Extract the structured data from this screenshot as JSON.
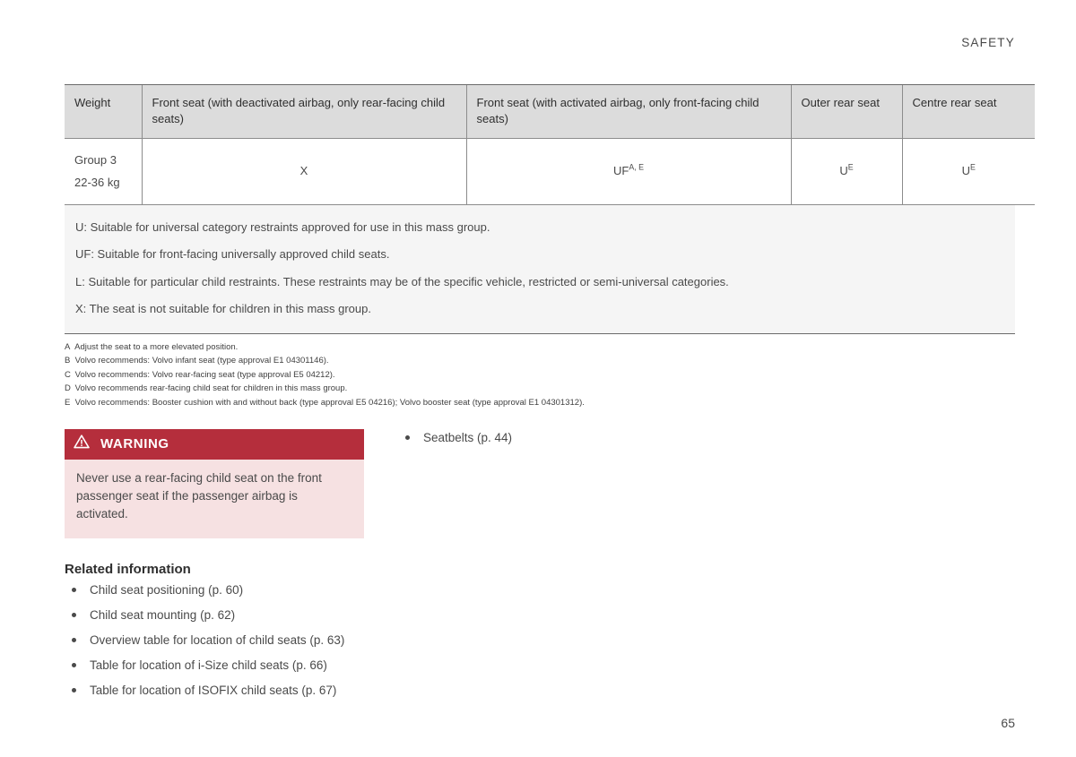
{
  "header": {
    "section_title": "SAFETY"
  },
  "page": {
    "number": "65"
  },
  "table": {
    "columns": [
      "Weight",
      "Front seat (with deactivated airbag, only rear-facing child seats)",
      "Front seat (with activated airbag, only front-facing child seats)",
      "Outer rear seat",
      "Centre rear seat"
    ],
    "row": {
      "weight_group": "Group 3",
      "weight_range": "22-36 kg",
      "front_deactivated": "X",
      "front_activated_code": "UF",
      "front_activated_sup": "A, E",
      "outer_rear_code": "U",
      "outer_rear_sup": "E",
      "centre_rear_code": "U",
      "centre_rear_sup": "E"
    }
  },
  "legend": [
    "U: Suitable for universal category restraints approved for use in this mass group.",
    "UF: Suitable for front-facing universally approved child seats.",
    "L: Suitable for particular child restraints. These restraints may be of the specific vehicle, restricted or semi-universal categories.",
    "X: The seat is not suitable for children in this mass group."
  ],
  "footnotes": [
    {
      "mark": "A",
      "text": "Adjust the seat to a more elevated position."
    },
    {
      "mark": "B",
      "text": "Volvo recommends: Volvo infant seat (type approval E1 04301146)."
    },
    {
      "mark": "C",
      "text": "Volvo recommends: Volvo rear-facing seat (type approval E5 04212)."
    },
    {
      "mark": "D",
      "text": "Volvo recommends rear-facing child seat for children in this mass group."
    },
    {
      "mark": "E",
      "text": "Volvo recommends: Booster cushion with and without back (type approval E5 04216); Volvo booster seat (type approval E1 04301312)."
    }
  ],
  "warning": {
    "icon": "warning-triangle-icon",
    "title": "WARNING",
    "text": "Never use a rear-facing child seat on the front passenger seat if the passenger airbag is activated."
  },
  "related": {
    "title": "Related information",
    "left_items": [
      "Child seat positioning (p. 60)",
      "Child seat mounting (p. 62)",
      "Overview table for location of child seats (p. 63)",
      "Table for location of i-Size child seats (p. 66)",
      "Table for location of ISOFIX child seats (p. 67)"
    ],
    "right_items": [
      "Seatbelts (p. 44)"
    ]
  },
  "colors": {
    "warning_red": "#b52e3c",
    "warning_body_pink": "#f6e1e2",
    "table_header_gray": "#dcdcdc",
    "notes_panel_gray": "#f5f5f5",
    "rule_gray": "#6a6a6a"
  }
}
